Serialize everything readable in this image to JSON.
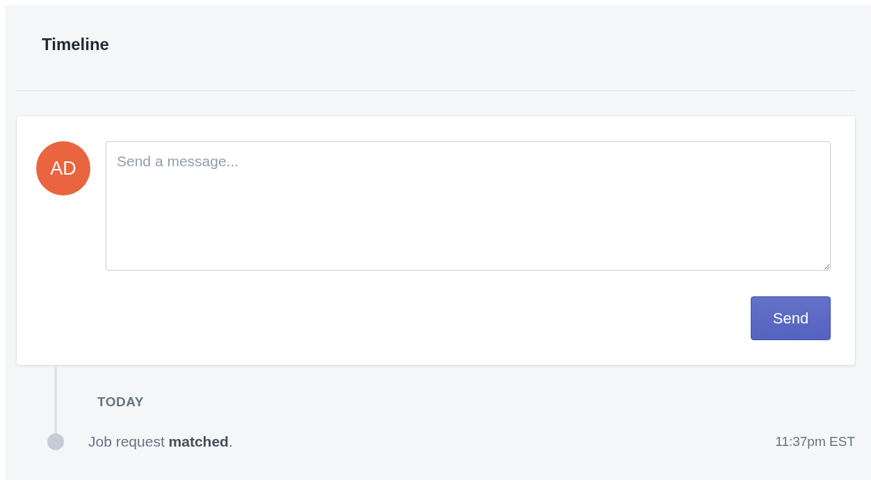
{
  "title": "Timeline",
  "composer": {
    "avatar_initials": "AD",
    "placeholder": "Send a message...",
    "button": "Send"
  },
  "timeline": {
    "groups": [
      {
        "label": "TODAY",
        "events": [
          {
            "text": "Job request **matched**.",
            "time": "11:37pm EST"
          }
        ]
      }
    ]
  }
}
